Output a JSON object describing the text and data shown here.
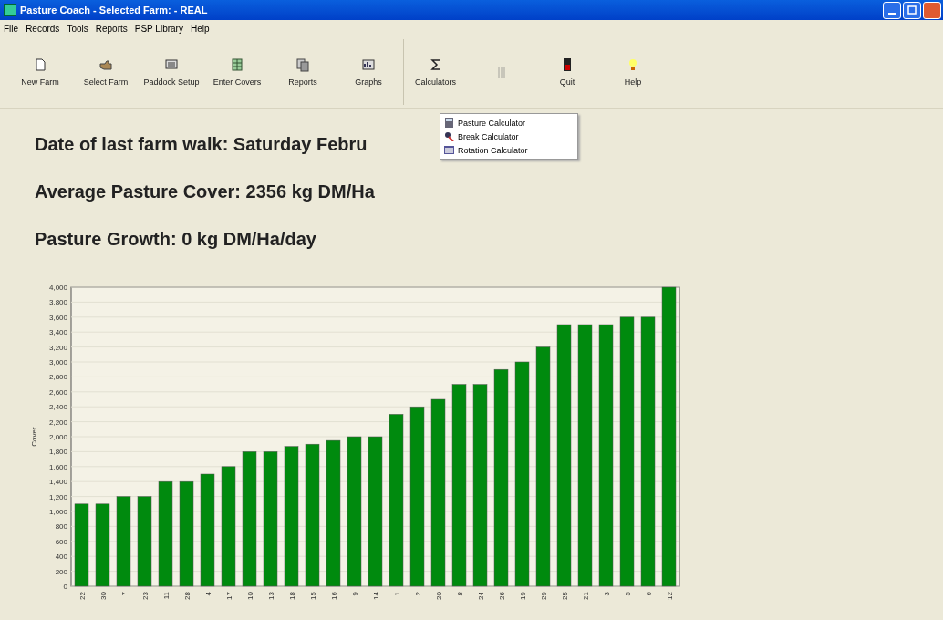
{
  "window": {
    "title": "Pasture Coach - Selected Farm: - REAL"
  },
  "menu_bar": [
    "File",
    "Records",
    "Tools",
    "Reports",
    "PSP Library",
    "Help"
  ],
  "toolbar": [
    {
      "label": "New Farm",
      "disabled": false
    },
    {
      "label": "Select Farm",
      "disabled": false
    },
    {
      "label": "Paddock Setup",
      "disabled": false
    },
    {
      "label": "Enter Covers",
      "disabled": false
    },
    {
      "label": "Reports",
      "disabled": false
    },
    {
      "label": "Graphs",
      "disabled": false
    },
    {
      "label": "Calculators",
      "disabled": false
    },
    {
      "disabled": true
    },
    {
      "label": "Quit",
      "disabled": false
    },
    {
      "label": "Help",
      "disabled": false
    }
  ],
  "dropdown_menu": [
    "Pasture Calculator",
    "Break Calculator",
    "Rotation Calculator"
  ],
  "summary": [
    "Date of last farm walk: Saturday Febru",
    "Average Pasture Cover: 2356 kg DM/Ha",
    "Pasture Growth: 0 kg DM/Ha/day"
  ],
  "chart_data": {
    "type": "bar",
    "ylabel": "Cover",
    "categories": [
      "22",
      "30",
      "7",
      "23",
      "11",
      "28",
      "4",
      "17",
      "10",
      "13",
      "18",
      "15",
      "16",
      "9",
      "14",
      "1",
      "2",
      "20",
      "8",
      "24",
      "26",
      "19",
      "29",
      "25",
      "21",
      "3",
      "5",
      "6",
      "12"
    ],
    "values": [
      1100,
      1100,
      1200,
      1200,
      1400,
      1400,
      1500,
      1600,
      1800,
      1800,
      1870,
      1900,
      1950,
      2000,
      2000,
      2300,
      2400,
      2500,
      2700,
      2700,
      2900,
      3000,
      3200,
      3500,
      3500,
      3500,
      3600,
      3600,
      4000
    ],
    "ylim": [
      0,
      4000
    ],
    "grid": true,
    "yticks": [
      {
        "value": 0,
        "label": "0"
      },
      {
        "value": 200,
        "label": "200"
      },
      {
        "value": 400,
        "label": "400"
      },
      {
        "value": 600,
        "label": "600"
      },
      {
        "value": 800,
        "label": "800"
      },
      {
        "value": 1000,
        "label": "1,000"
      },
      {
        "value": 1200,
        "label": "1,200"
      },
      {
        "value": 1400,
        "label": "1,400"
      },
      {
        "value": 1600,
        "label": "1,600"
      },
      {
        "value": 1800,
        "label": "1,800"
      },
      {
        "value": 2000,
        "label": "2,000"
      },
      {
        "value": 2200,
        "label": "2,200"
      },
      {
        "value": 2400,
        "label": "2,400"
      },
      {
        "value": 2600,
        "label": "2,600"
      },
      {
        "value": 2800,
        "label": "2,800"
      },
      {
        "value": 3000,
        "label": "3,000"
      },
      {
        "value": 3200,
        "label": "3,200"
      },
      {
        "value": 3400,
        "label": "3,400"
      },
      {
        "value": 3600,
        "label": "3,600"
      },
      {
        "value": 3800,
        "label": "3,800"
      },
      {
        "value": 4000,
        "label": "4,000"
      }
    ]
  }
}
